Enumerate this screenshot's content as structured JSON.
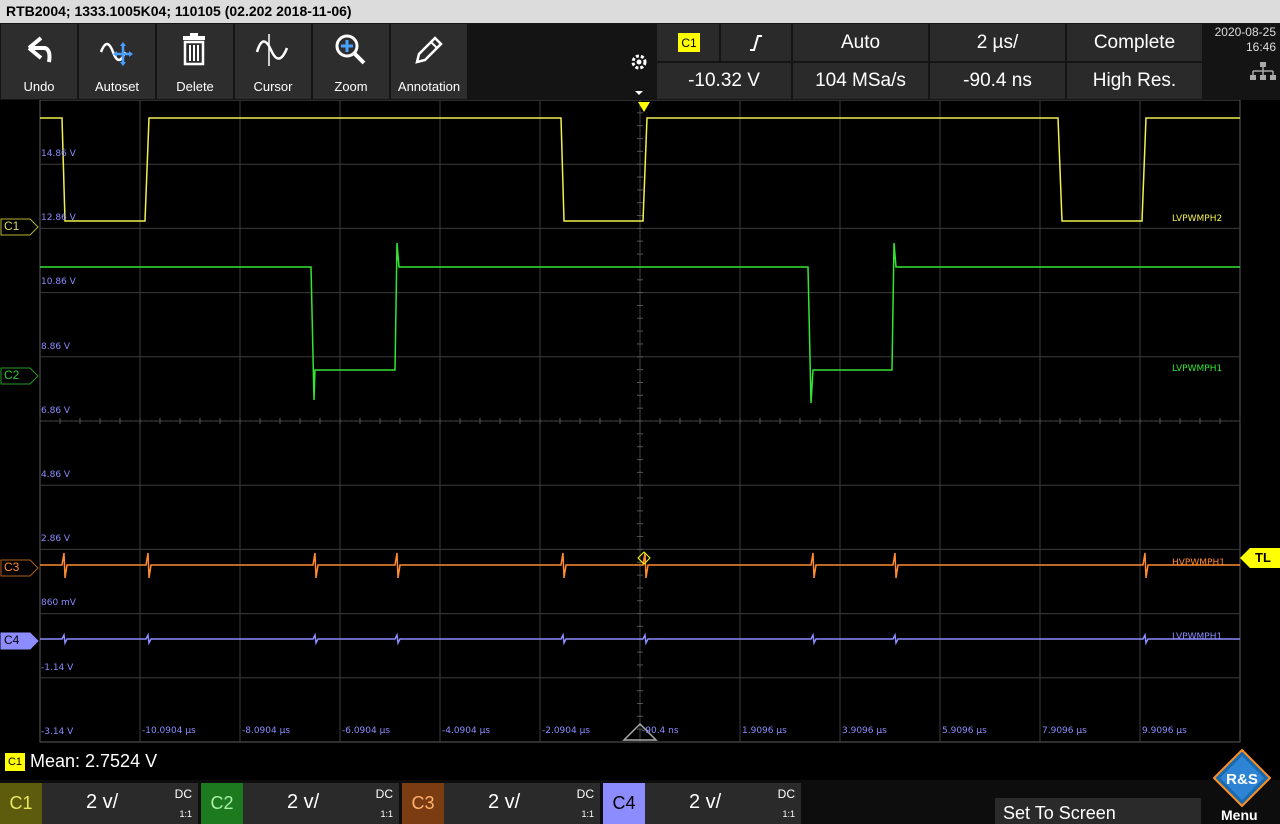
{
  "window": {
    "title": "RTB2004; 1333.1005K04; 110105 (02.202 2018-11-06)"
  },
  "toolbar": {
    "buttons": [
      {
        "label": "Undo",
        "icon": "undo-icon"
      },
      {
        "label": "Autoset",
        "icon": "autoset-icon"
      },
      {
        "label": "Delete",
        "icon": "trash-icon"
      },
      {
        "label": "Cursor",
        "icon": "cursor-wave-icon"
      },
      {
        "label": "Zoom",
        "icon": "zoom-icon"
      },
      {
        "label": "Annotation",
        "icon": "pencil-icon"
      }
    ]
  },
  "trigger": {
    "source": "C1",
    "slope_icon": "rising-edge-icon",
    "mode": "Auto",
    "timebase": "2 µs/",
    "acq_state": "Complete",
    "level": "-10.32 V",
    "sample_rate": "104 MSa/s",
    "position": "-90.4 ns",
    "acq_mode": "High Res."
  },
  "datetime": {
    "date": "2020-08-25",
    "time": "16:46"
  },
  "grid": {
    "voltage_labels": [
      "14.86 V",
      "12.86 V",
      "10.86 V",
      "8.86 V",
      "6.86 V",
      "4.86 V",
      "2.86 V",
      "860 mV",
      "-1.14 V",
      "-3.14 V"
    ],
    "time_labels": [
      "-10.0904 µs",
      "-8.0904 µs",
      "-6.0904 µs",
      "-4.0904 µs",
      "-2.0904 µs",
      "-90.4 ns",
      "1.9096 µs",
      "3.9096 µs",
      "5.9096 µs",
      "7.9096 µs",
      "9.9096 µs"
    ]
  },
  "channels": [
    {
      "id": "C1",
      "label": "LVPWMPH2",
      "color": "#f0f050",
      "scale": "2 v/",
      "coupling": "DC",
      "ratio": "1:1"
    },
    {
      "id": "C2",
      "label": "LVPWMPH1",
      "color": "#32e632",
      "scale": "2 v/",
      "coupling": "DC",
      "ratio": "1:1"
    },
    {
      "id": "C3",
      "label": "HVPWMPH1",
      "color": "#ff8a30",
      "scale": "2 v/",
      "coupling": "DC",
      "ratio": "1:1"
    },
    {
      "id": "C4",
      "label": "LVPWMPH1",
      "color": "#8c8cff",
      "scale": "2 v/",
      "coupling": "DC",
      "ratio": "1:1"
    }
  ],
  "trigger_level_tag": "TL",
  "measurement": {
    "channel": "C1",
    "text": "Mean: 2.7524 V"
  },
  "bottom": {
    "set_to_screen": "Set To Screen",
    "menu_label": "Menu",
    "logo_text": "R&S"
  }
}
